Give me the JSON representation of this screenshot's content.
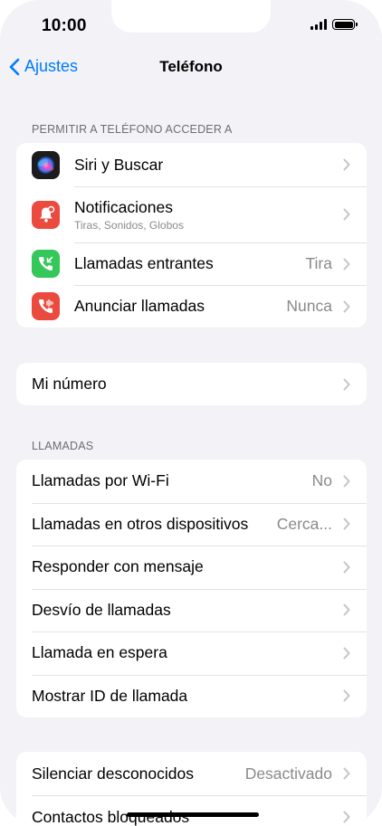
{
  "status_bar": {
    "time": "10:00"
  },
  "nav": {
    "back_label": "Ajustes",
    "title": "Teléfono"
  },
  "section_access": {
    "header": "PERMITIR A TELÉFONO ACCEDER A",
    "items": [
      {
        "label": "Siri y Buscar",
        "icon": "siri-icon"
      },
      {
        "label": "Notificaciones",
        "subtitle": "Tiras, Sonidos, Globos",
        "icon": "notifications-icon"
      },
      {
        "label": "Llamadas entrantes",
        "value": "Tira",
        "icon": "incoming-call-icon"
      },
      {
        "label": "Anunciar llamadas",
        "value": "Nunca",
        "icon": "announce-calls-icon"
      }
    ]
  },
  "section_number": {
    "items": [
      {
        "label": "Mi número"
      }
    ]
  },
  "section_calls": {
    "header": "LLAMADAS",
    "items": [
      {
        "label": "Llamadas por Wi-Fi",
        "value": "No"
      },
      {
        "label": "Llamadas en otros dispositivos",
        "value": "Cerca..."
      },
      {
        "label": "Responder con mensaje"
      },
      {
        "label": "Desvío de llamadas"
      },
      {
        "label": "Llamada en espera"
      },
      {
        "label": "Mostrar ID de llamada"
      }
    ]
  },
  "section_blocking": {
    "items": [
      {
        "label": "Silenciar desconocidos",
        "value": "Desactivado"
      },
      {
        "label": "Contactos bloqueados"
      }
    ]
  },
  "colors": {
    "accent": "#007aff",
    "notifications": "#eb4b3f",
    "incoming_calls": "#34c759",
    "announce_calls": "#eb4b3f"
  }
}
